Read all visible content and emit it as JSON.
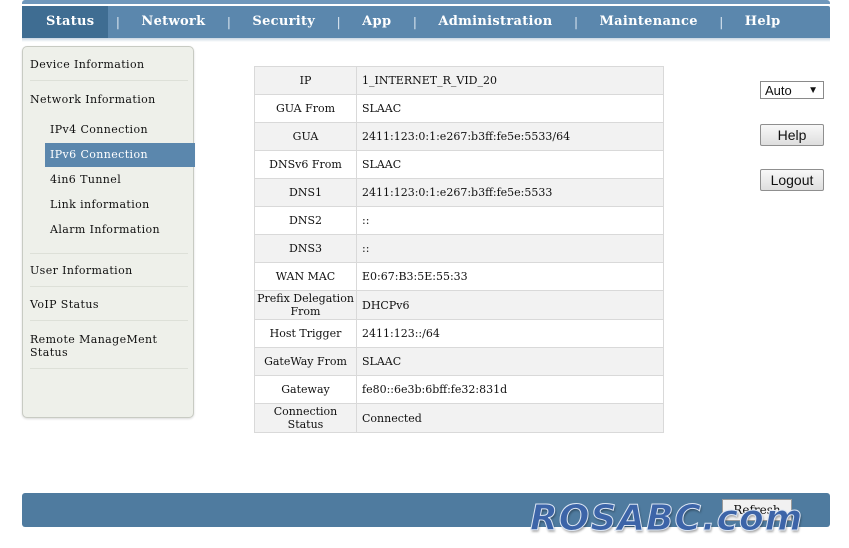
{
  "nav": {
    "items": [
      "Status",
      "Network",
      "Security",
      "App",
      "Administration",
      "Maintenance",
      "Help"
    ],
    "separator": "|"
  },
  "sidebar": {
    "device_information": "Device Information",
    "network_information": "Network Information",
    "sub_items": [
      "IPv4 Connection",
      "IPv6 Connection",
      "4in6 Tunnel",
      "Link information",
      "Alarm Information"
    ],
    "user_information": "User Information",
    "voip_status": "VoIP Status",
    "remote_management": "Remote ManageMent Status"
  },
  "table": {
    "rows": [
      {
        "key": "IP",
        "value": "1_INTERNET_R_VID_20"
      },
      {
        "key": "GUA From",
        "value": "SLAAC"
      },
      {
        "key": "GUA",
        "value": "2411:123:0:1:e267:b3ff:fe5e:5533/64"
      },
      {
        "key": "DNSv6 From",
        "value": "SLAAC"
      },
      {
        "key": "DNS1",
        "value": "2411:123:0:1:e267:b3ff:fe5e:5533"
      },
      {
        "key": "DNS2",
        "value": "::"
      },
      {
        "key": "DNS3",
        "value": "::"
      },
      {
        "key": "WAN MAC",
        "value": "E0:67:B3:5E:55:33"
      },
      {
        "key": "Prefix Delegation From",
        "value": "DHCPv6"
      },
      {
        "key": "Host Trigger",
        "value": "2411:123::/64"
      },
      {
        "key": "GateWay From",
        "value": "SLAAC"
      },
      {
        "key": "Gateway",
        "value": "fe80::6e3b:6bff:fe32:831d"
      },
      {
        "key": "Connection Status",
        "value": "Connected"
      }
    ]
  },
  "controls": {
    "language_selected": "Auto",
    "help_label": "Help",
    "logout_label": "Logout",
    "refresh_label": "Refresh"
  },
  "watermark": "ROSABC.com",
  "colors": {
    "nav_bg": "#5b87ad",
    "nav_active": "#3f6d92",
    "sidebar_active": "#5b87ad",
    "bottom_bar": "#4f7b9f"
  }
}
